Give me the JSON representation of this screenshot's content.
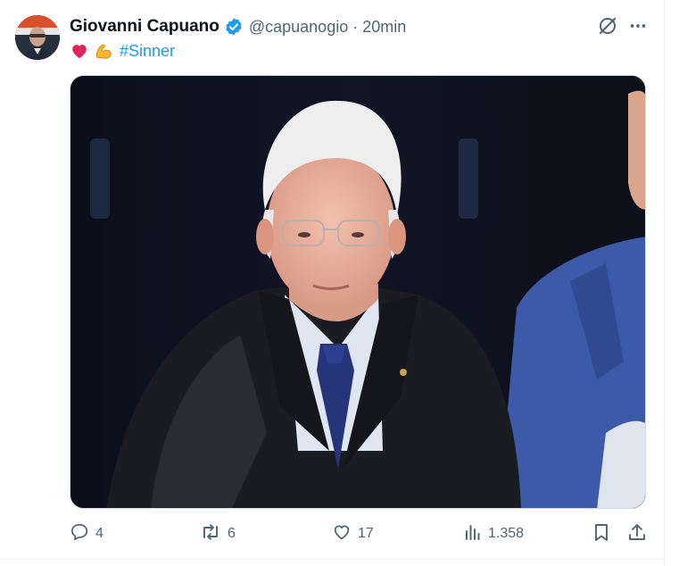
{
  "tweet": {
    "author_name": "Giovanni Capuano",
    "handle": "@capuanogio",
    "separator": "·",
    "time": "20min",
    "text_hashtag": "#Sinner",
    "emojis": [
      "red-heart",
      "flexed-biceps"
    ],
    "media_alt": "photo"
  },
  "stats": {
    "replies": "4",
    "reposts": "6",
    "likes": "17",
    "views": "1.358"
  },
  "colors": {
    "text": "#0f1419",
    "muted": "#536471",
    "link": "#1d9bf0",
    "verified": "#1d9bf0",
    "heart": "#e0245e"
  },
  "icons": {
    "verified": "verified-badge-icon",
    "grok": "grok-icon",
    "more": "more-icon",
    "reply": "reply-icon",
    "repost": "repost-icon",
    "like": "like-icon",
    "views": "views-icon",
    "bookmark": "bookmark-icon",
    "share": "share-icon"
  }
}
